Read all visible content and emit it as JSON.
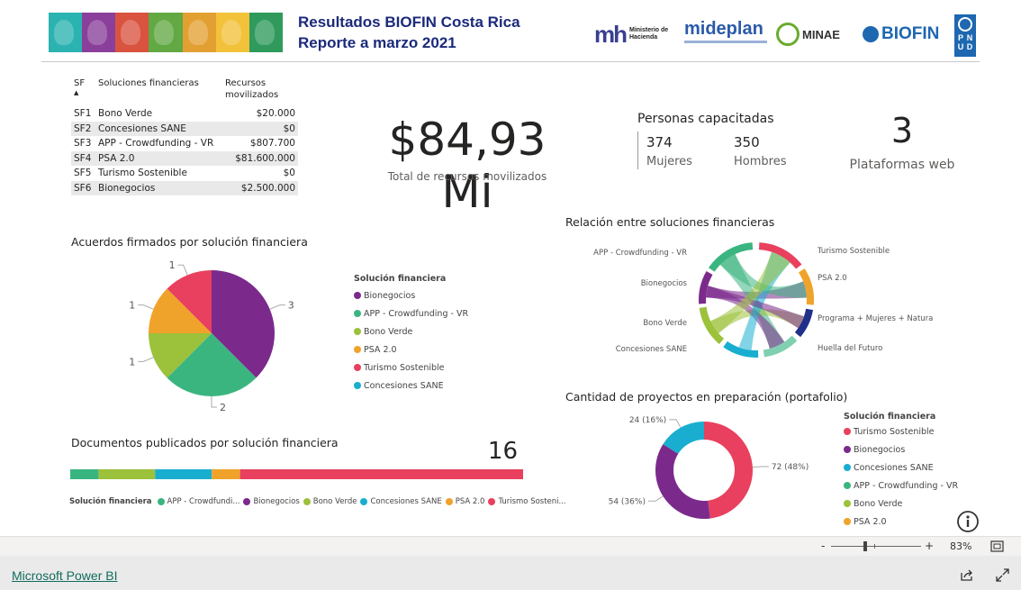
{
  "header": {
    "title_line1": "Resultados BIOFIN Costa Rica",
    "title_line2": "Reporte a marzo 2021",
    "banner_colors": [
      "#2bb3b1",
      "#8a3f9a",
      "#d9533f",
      "#62a843",
      "#e3a032",
      "#f2c23a",
      "#2f9a5c"
    ],
    "logos": {
      "hacienda_mark": "mh",
      "hacienda_text_1": "Ministerio de",
      "hacienda_text_2": "Hacienda",
      "mideplan": "mideplan",
      "minae": "MINAE",
      "biofin": "BIOFIN",
      "pnud_letters": [
        "P",
        "N",
        "U",
        "D"
      ]
    }
  },
  "table": {
    "columns": [
      "SF",
      "Soluciones financieras",
      "Recursos movilizados"
    ],
    "rows": [
      {
        "sf": "SF1",
        "name": "Bono Verde",
        "amount": "$20.000"
      },
      {
        "sf": "SF2",
        "name": "Concesiones SANE",
        "amount": "$0"
      },
      {
        "sf": "SF3",
        "name": "APP - Crowdfunding - VR",
        "amount": "$807.700"
      },
      {
        "sf": "SF4",
        "name": "PSA 2.0",
        "amount": "$81.600.000"
      },
      {
        "sf": "SF5",
        "name": "Turismo Sostenible",
        "amount": "$0"
      },
      {
        "sf": "SF6",
        "name": "Bionegocios",
        "amount": "$2.500.000"
      }
    ]
  },
  "kpi": {
    "total_value": "$84,93 Mi",
    "total_label": "Total de recursos movilizados",
    "trained_title": "Personas capacitadas",
    "women_value": "374",
    "women_label": "Mujeres",
    "men_value": "350",
    "men_label": "Hombres",
    "platforms_value": "3",
    "platforms_label": "Plataformas web"
  },
  "colors": {
    "Bionegocios": "#7b2a8c",
    "APP - Crowdfunding - VR": "#3bb580",
    "Bono Verde": "#9cc13b",
    "PSA 2.0": "#f0a32a",
    "Turismo Sostenible": "#e8405e",
    "Concesiones SANE": "#19aed0",
    "Programa + Mujeres + Natura": "#1f2f8a",
    "Huella del Futuro": "#7fd0b0"
  },
  "pie": {
    "title": "Acuerdos firmados por solución financiera",
    "legend_title": "Solución financiera",
    "legend": [
      "Bionegocios",
      "APP - Crowdfunding - VR",
      "Bono Verde",
      "PSA 2.0",
      "Turismo Sostenible",
      "Concesiones SANE"
    ]
  },
  "chord": {
    "title": "Relación entre soluciones financieras",
    "labels": [
      "Turismo Sostenible",
      "PSA 2.0",
      "Programa + Mujeres + Natura",
      "Huella del Futuro",
      "Concesiones SANE",
      "Bono Verde",
      "Bionegocios",
      "APP - Crowdfunding - VR"
    ]
  },
  "stacked": {
    "title": "Documentos publicados por solución financiera",
    "total": "16",
    "legend_title": "Solución financiera",
    "legend": [
      "APP - Crowdfundi...",
      "Bionegocios",
      "Bono Verde",
      "Concesiones SANE",
      "PSA 2.0",
      "Turismo Sosteni..."
    ]
  },
  "donut": {
    "title": "Cantidad de proyectos en preparación (portafolio)",
    "legend_title": "Solución financiera",
    "legend": [
      "Turismo Sostenible",
      "Bionegocios",
      "Concesiones SANE",
      "APP - Crowdfunding - VR",
      "Bono Verde",
      "PSA 2.0"
    ]
  },
  "chart_data": [
    {
      "type": "pie",
      "title": "Acuerdos firmados por solución financiera",
      "categories": [
        "Bionegocios",
        "APP - Crowdfunding - VR",
        "Bono Verde",
        "PSA 2.0",
        "Turismo Sostenible"
      ],
      "values": [
        3,
        2,
        1,
        1,
        1
      ],
      "data_labels": [
        "3",
        "2",
        "1",
        "1",
        "1"
      ],
      "legend_title": "Solución financiera",
      "legend_placement": "right"
    },
    {
      "type": "bar",
      "title": "Documentos publicados por solución financiera",
      "orientation": "horizontal-stacked-100",
      "categories": [
        "APP - Crowdfunding - VR",
        "Bionegocios",
        "Bono Verde",
        "Concesiones SANE",
        "PSA 2.0",
        "Turismo Sostenible"
      ],
      "values": [
        1,
        0,
        2,
        2,
        1,
        10
      ],
      "total": 16,
      "legend_title": "Solución financiera",
      "legend_placement": "bottom"
    },
    {
      "type": "pie",
      "subtype": "donut",
      "title": "Cantidad de proyectos en preparación (portafolio)",
      "categories": [
        "Turismo Sostenible",
        "Bionegocios",
        "Concesiones SANE",
        "APP - Crowdfunding - VR",
        "Bono Verde",
        "PSA 2.0"
      ],
      "values": [
        72,
        54,
        24,
        0,
        0,
        0
      ],
      "data_labels": [
        "72 (48%)",
        "54 (36%)",
        "24 (16%)"
      ],
      "legend_title": "Solución financiera",
      "legend_placement": "right"
    }
  ],
  "zoom": {
    "minus": "-",
    "plus": "+",
    "level": "83%",
    "level_fraction": 0.83
  },
  "footer": {
    "link": "Microsoft Power BI"
  },
  "icons": [
    "info-icon",
    "fit-to-page-icon",
    "share-icon",
    "fullscreen-icon"
  ]
}
